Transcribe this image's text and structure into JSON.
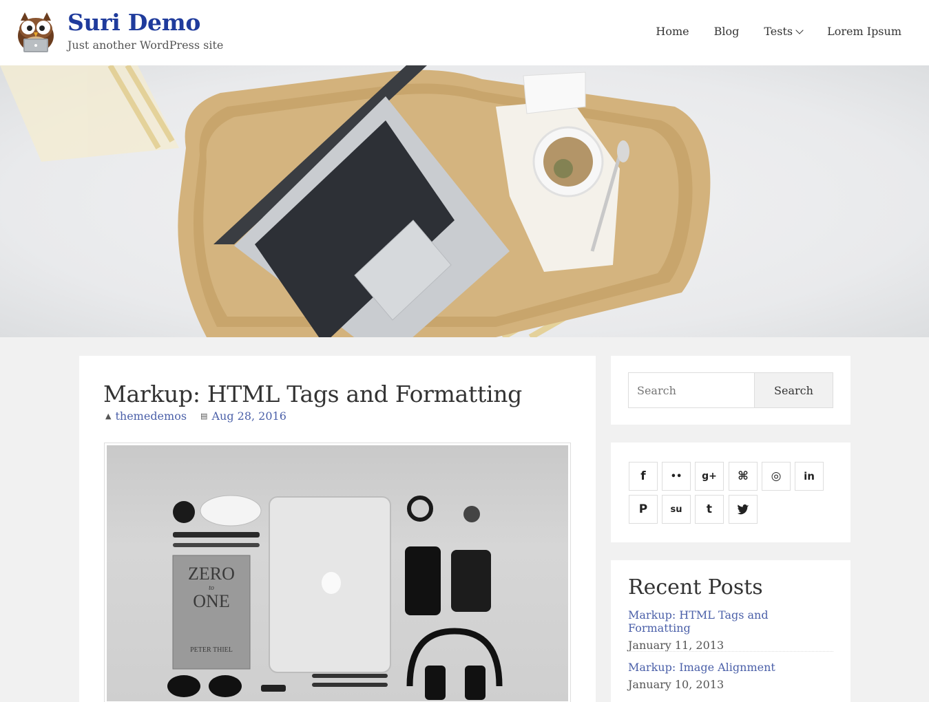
{
  "site": {
    "title": "Suri Demo",
    "description": "Just another WordPress site"
  },
  "nav": {
    "items": [
      "Home",
      "Blog",
      "Tests",
      "Lorem Ipsum"
    ]
  },
  "post": {
    "title": "Markup: HTML Tags and Formatting",
    "author": "themedemos",
    "date": "Aug 28, 2016"
  },
  "featured_image": {
    "book_line1": "ZERO",
    "book_line2": "to",
    "book_line3": "ONE",
    "book_author": "PETER THIEL"
  },
  "search": {
    "placeholder": "Search",
    "button_label": "Search"
  },
  "social": {
    "icons": [
      "facebook-icon",
      "flickr-icon",
      "google-plus-icon",
      "github-icon",
      "instagram-icon",
      "linkedin-icon",
      "pinterest-icon",
      "stumbleupon-icon",
      "tumblr-icon",
      "twitter-icon"
    ],
    "glyphs": [
      "f",
      "••",
      "g+",
      "⌘",
      "◎",
      "in",
      "P",
      "su",
      "t",
      "t"
    ]
  },
  "recent_posts": {
    "title": "Recent Posts",
    "items": [
      {
        "title": "Markup: HTML Tags and Formatting",
        "date": "January 11, 2013"
      },
      {
        "title": "Markup: Image Alignment",
        "date": "January 10, 2013"
      }
    ]
  },
  "colors": {
    "title_blue": "#1f3b9c",
    "link_blue": "#4a5fa8"
  }
}
